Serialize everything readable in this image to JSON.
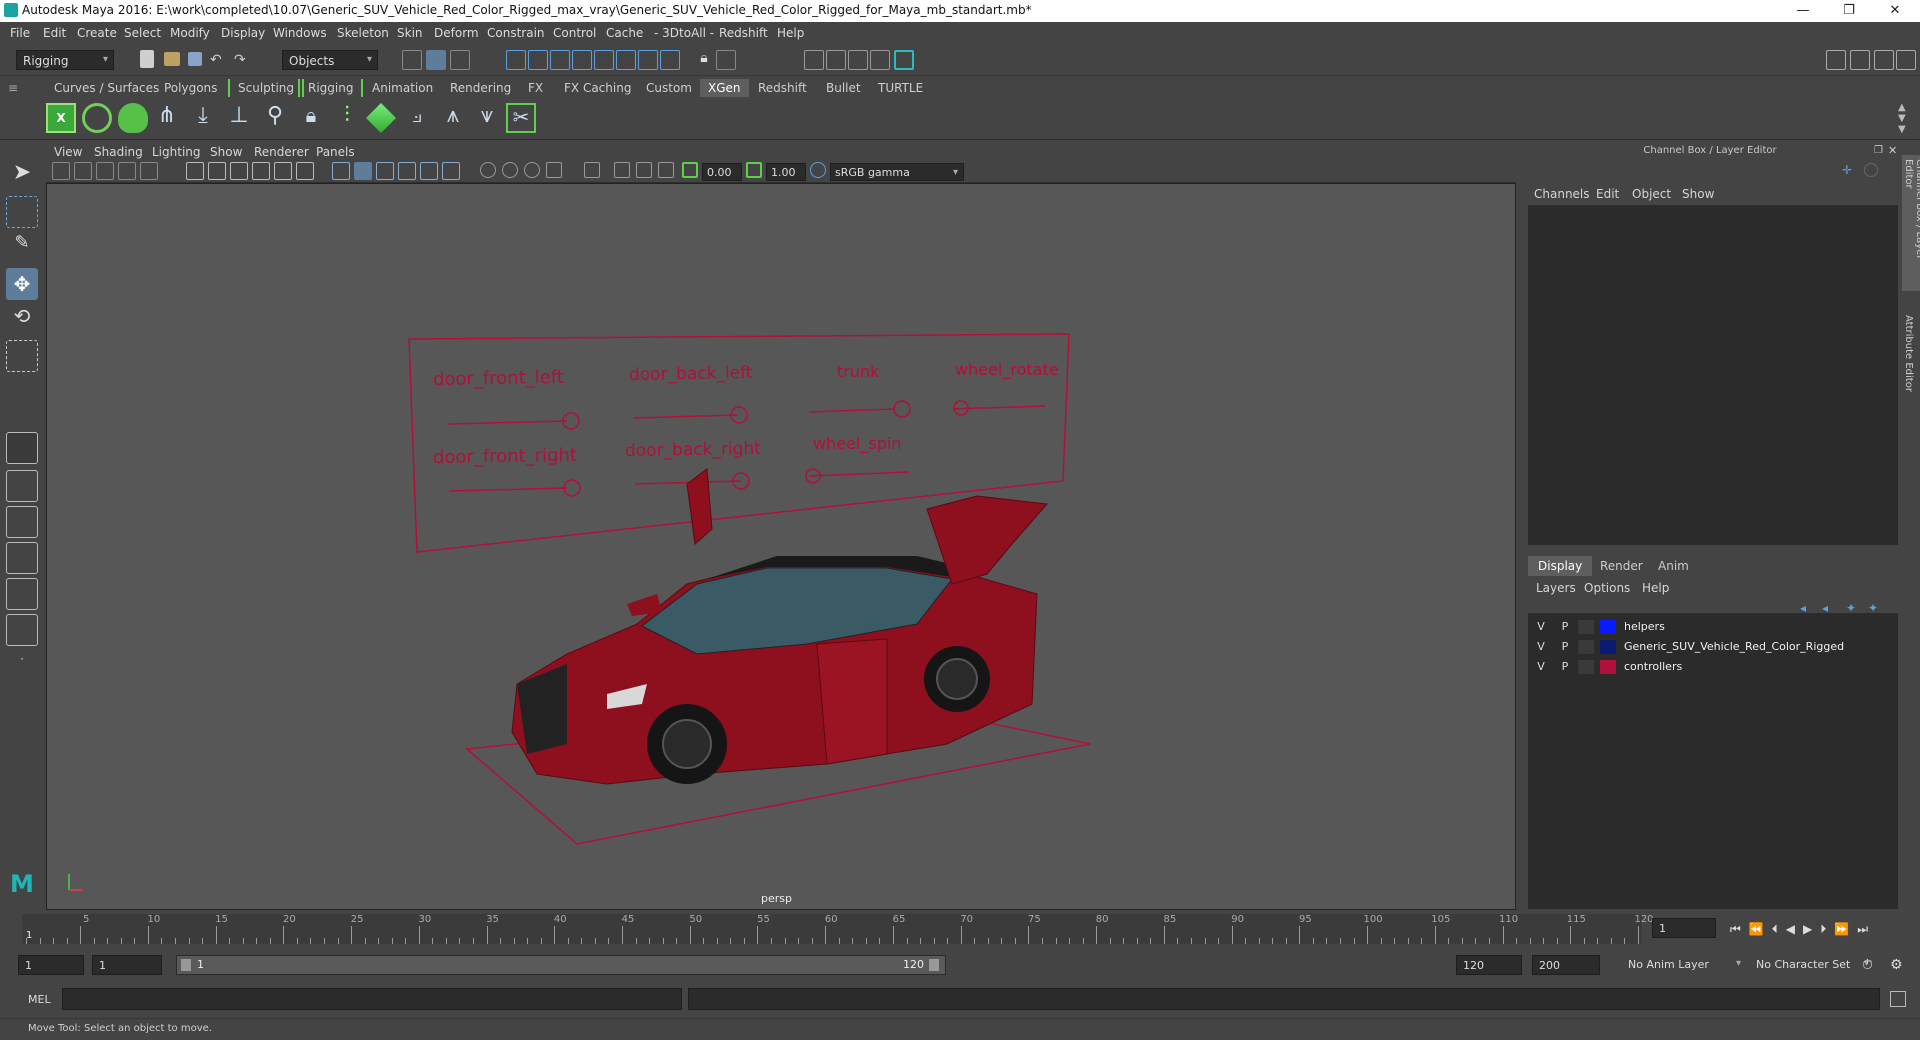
{
  "window": {
    "title": "Autodesk Maya 2016: E:\\work\\completed\\10.07\\Generic_SUV_Vehicle_Red_Color_Rigged_max_vray\\Generic_SUV_Vehicle_Red_Color_Rigged_for_Maya_mb_standart.mb*",
    "minimize": "—",
    "restore": "❐",
    "close": "✕"
  },
  "menubar": [
    "File",
    "Edit",
    "Create",
    "Select",
    "Modify",
    "Display",
    "Windows",
    "Skeleton",
    "Skin",
    "Deform",
    "Constrain",
    "Control",
    "Cache",
    "- 3DtoAll -",
    "Redshift",
    "Help"
  ],
  "statusline": {
    "mode": "Rigging",
    "objects_field": "Objects"
  },
  "shelf_tabs": [
    "Curves / Surfaces",
    "Polygons",
    "Sculpting",
    "Rigging",
    "Animation",
    "Rendering",
    "FX",
    "FX Caching",
    "Custom",
    "XGen",
    "Redshift",
    "Bullet",
    "TURTLE"
  ],
  "shelf_active": "XGen",
  "viewport": {
    "menu": [
      "View",
      "Shading",
      "Lighting",
      "Show",
      "Renderer",
      "Panels"
    ],
    "exposure": "0.00",
    "gamma": "1.00",
    "colorspace": "sRGB gamma",
    "camera": "persp",
    "controller_labels": [
      "door_front_left",
      "door_back_left",
      "trunk",
      "wheel_rotate",
      "door_front_right",
      "door_back_right",
      "wheel_spin"
    ],
    "controller_color": "#b0103a",
    "car_color": "#8e0f1e"
  },
  "right_panel": {
    "title": "Channel Box / Layer Editor",
    "menu": [
      "Channels",
      "Edit",
      "Object",
      "Show"
    ],
    "tabs": [
      "Display",
      "Render",
      "Anim"
    ],
    "active_tab": "Display",
    "layer_menu": [
      "Layers",
      "Options",
      "Help"
    ],
    "layers": [
      {
        "v": "V",
        "p": "P",
        "name": "helpers",
        "color": "#0a1aff"
      },
      {
        "v": "V",
        "p": "P",
        "name": "Generic_SUV_Vehicle_Red_Color_Rigged",
        "color": "#0a1a6e"
      },
      {
        "v": "V",
        "p": "P",
        "name": "controllers",
        "color": "#b0103a"
      }
    ],
    "side_tabs": [
      "Channel Box / Layer Editor",
      "Attribute Editor"
    ]
  },
  "timeline": {
    "ticks": [
      "5",
      "10",
      "15",
      "20",
      "25",
      "30",
      "35",
      "40",
      "45",
      "50",
      "55",
      "60",
      "65",
      "70",
      "75",
      "80",
      "85",
      "90",
      "95",
      "100",
      "105",
      "110",
      "115",
      "120"
    ],
    "start_label": "1",
    "current_frame": "1"
  },
  "range": {
    "start": "1",
    "start2": "1",
    "slider_start": "1",
    "slider_end": "120",
    "end": "120",
    "end2": "200",
    "anim_layer": "No Anim Layer",
    "char_set": "No Character Set"
  },
  "cmdline": {
    "label": "MEL"
  },
  "helpline": {
    "text": "Move Tool: Select an object to move."
  }
}
